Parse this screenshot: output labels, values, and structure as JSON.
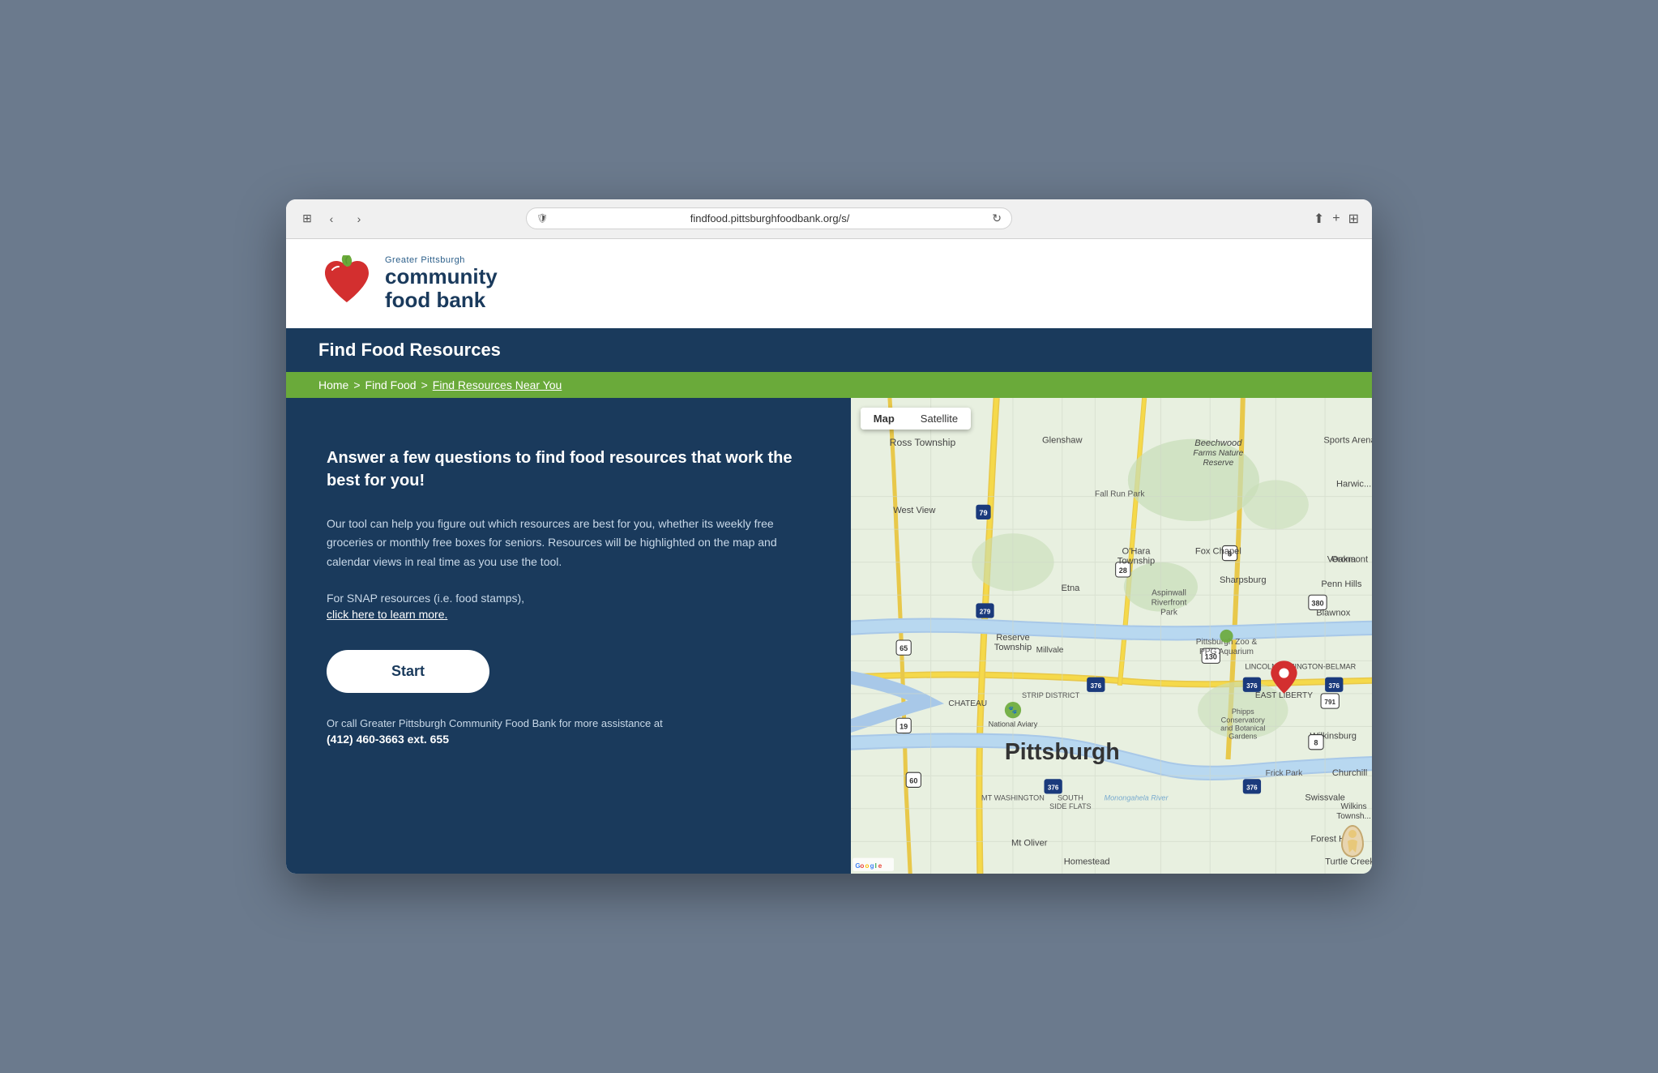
{
  "browser": {
    "url": "findfood.pittsburghfoodbank.org/s/",
    "tab_icon": "⊞"
  },
  "header": {
    "logo_greater_pittsburgh": "Greater Pittsburgh",
    "logo_community_food_bank": "community\nfood bank"
  },
  "nav": {
    "title": "Find Food Resources"
  },
  "breadcrumb": {
    "home": "Home",
    "separator1": ">",
    "find_food": "Find Food",
    "separator2": ">",
    "current": "Find Resources Near You"
  },
  "left_panel": {
    "heading": "Answer a few questions to find food resources that work the best for you!",
    "description": "Our tool can help you figure out which resources are best for you, whether its weekly free groceries or monthly free boxes for seniors. Resources will be highlighted on the map and calendar views in real time as you use the tool.",
    "snap_text": "For SNAP resources (i.e. food stamps),",
    "snap_link": "click here to learn more.",
    "start_button": "Start",
    "call_text": "Or call Greater Pittsburgh Community Food Bank for more assistance at",
    "call_number": "(412) 460-3663 ext. 655"
  },
  "map": {
    "toggle_map": "Map",
    "toggle_satellite": "Satellite"
  }
}
